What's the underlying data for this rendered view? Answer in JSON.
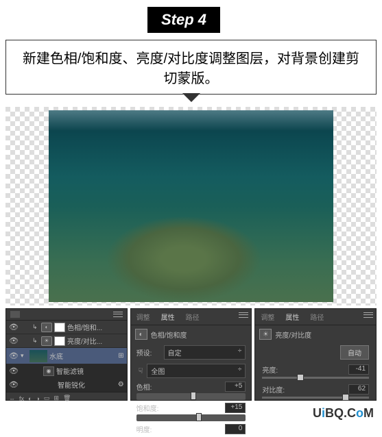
{
  "step_label": "Step 4",
  "instruction": "新建色相/饱和度、亮度/对比度调整图层，对背景创建剪切蒙版。",
  "layers": {
    "items": [
      {
        "name": "色相/饱和...",
        "type": "adjustment"
      },
      {
        "name": "亮度/对比...",
        "type": "adjustment"
      },
      {
        "name": "水底",
        "type": "image"
      },
      {
        "name": "智能滤镜",
        "type": "filter-group"
      },
      {
        "name": "智能锐化",
        "type": "filter"
      }
    ]
  },
  "hue_sat": {
    "tab_adjust": "调整",
    "tab_props": "属性",
    "tab_path": "路径",
    "title": "色相/饱和度",
    "preset_label": "预设:",
    "preset_value": "自定",
    "range_value": "全图",
    "hue_label": "色相:",
    "hue_value": "+5",
    "sat_label": "饱和度:",
    "sat_value": "+15",
    "light_label": "明度:",
    "light_value": "0"
  },
  "bright_contrast": {
    "tab_adjust": "调整",
    "tab_props": "属性",
    "tab_path": "路径",
    "title": "亮度/对比度",
    "auto_btn": "自动",
    "bright_label": "亮度:",
    "bright_value": "-41",
    "contrast_label": "对比度:",
    "contrast_value": "62"
  },
  "watermark": {
    "p1": "U",
    "p2": "i",
    "p3": "BQ.C",
    "p4": "o",
    "p5": "M"
  }
}
